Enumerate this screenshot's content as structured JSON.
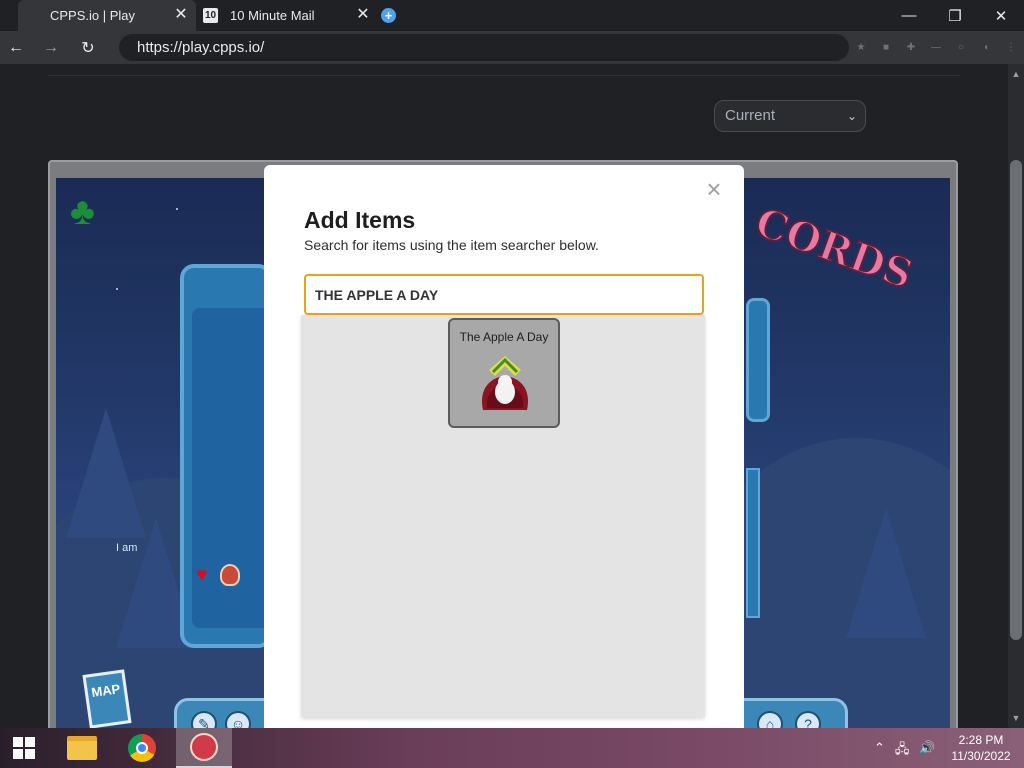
{
  "browser": {
    "tabs": [
      {
        "title": "CPPS.io | Play",
        "active": true
      },
      {
        "title": "10 Minute Mail",
        "active": false,
        "favicon_text": "10"
      }
    ],
    "close_glyph": "✕",
    "new_tab_glyph": "+",
    "window_controls": {
      "minimize": "—",
      "maximize": "❐",
      "close": "✕"
    },
    "nav": {
      "back": "←",
      "forward": "→",
      "reload": "↻"
    },
    "url": "https://play.cpps.io/"
  },
  "page": {
    "version_select": {
      "value": "Current",
      "chevron": "⌄"
    },
    "player_card_status": "I am",
    "map_label": "MAP",
    "records_sign": "CORDS"
  },
  "modal": {
    "close_glyph": "×",
    "title": "Add Items",
    "subtitle": "Search for items using the item searcher below.",
    "search_value": "THE APPLE A DAY",
    "results": [
      {
        "name": "The Apple A Day"
      }
    ]
  },
  "taskbar": {
    "clock_time": "2:28 PM",
    "clock_date": "11/30/2022",
    "tray": {
      "chevron": "⌃",
      "network": "🖧",
      "volume": "🔊"
    }
  },
  "colors": {
    "search_border": "#e8a31c",
    "modal_bg": "#ffffff",
    "results_bg": "#e4e4e4",
    "item_card_bg": "#a8a8a8"
  }
}
